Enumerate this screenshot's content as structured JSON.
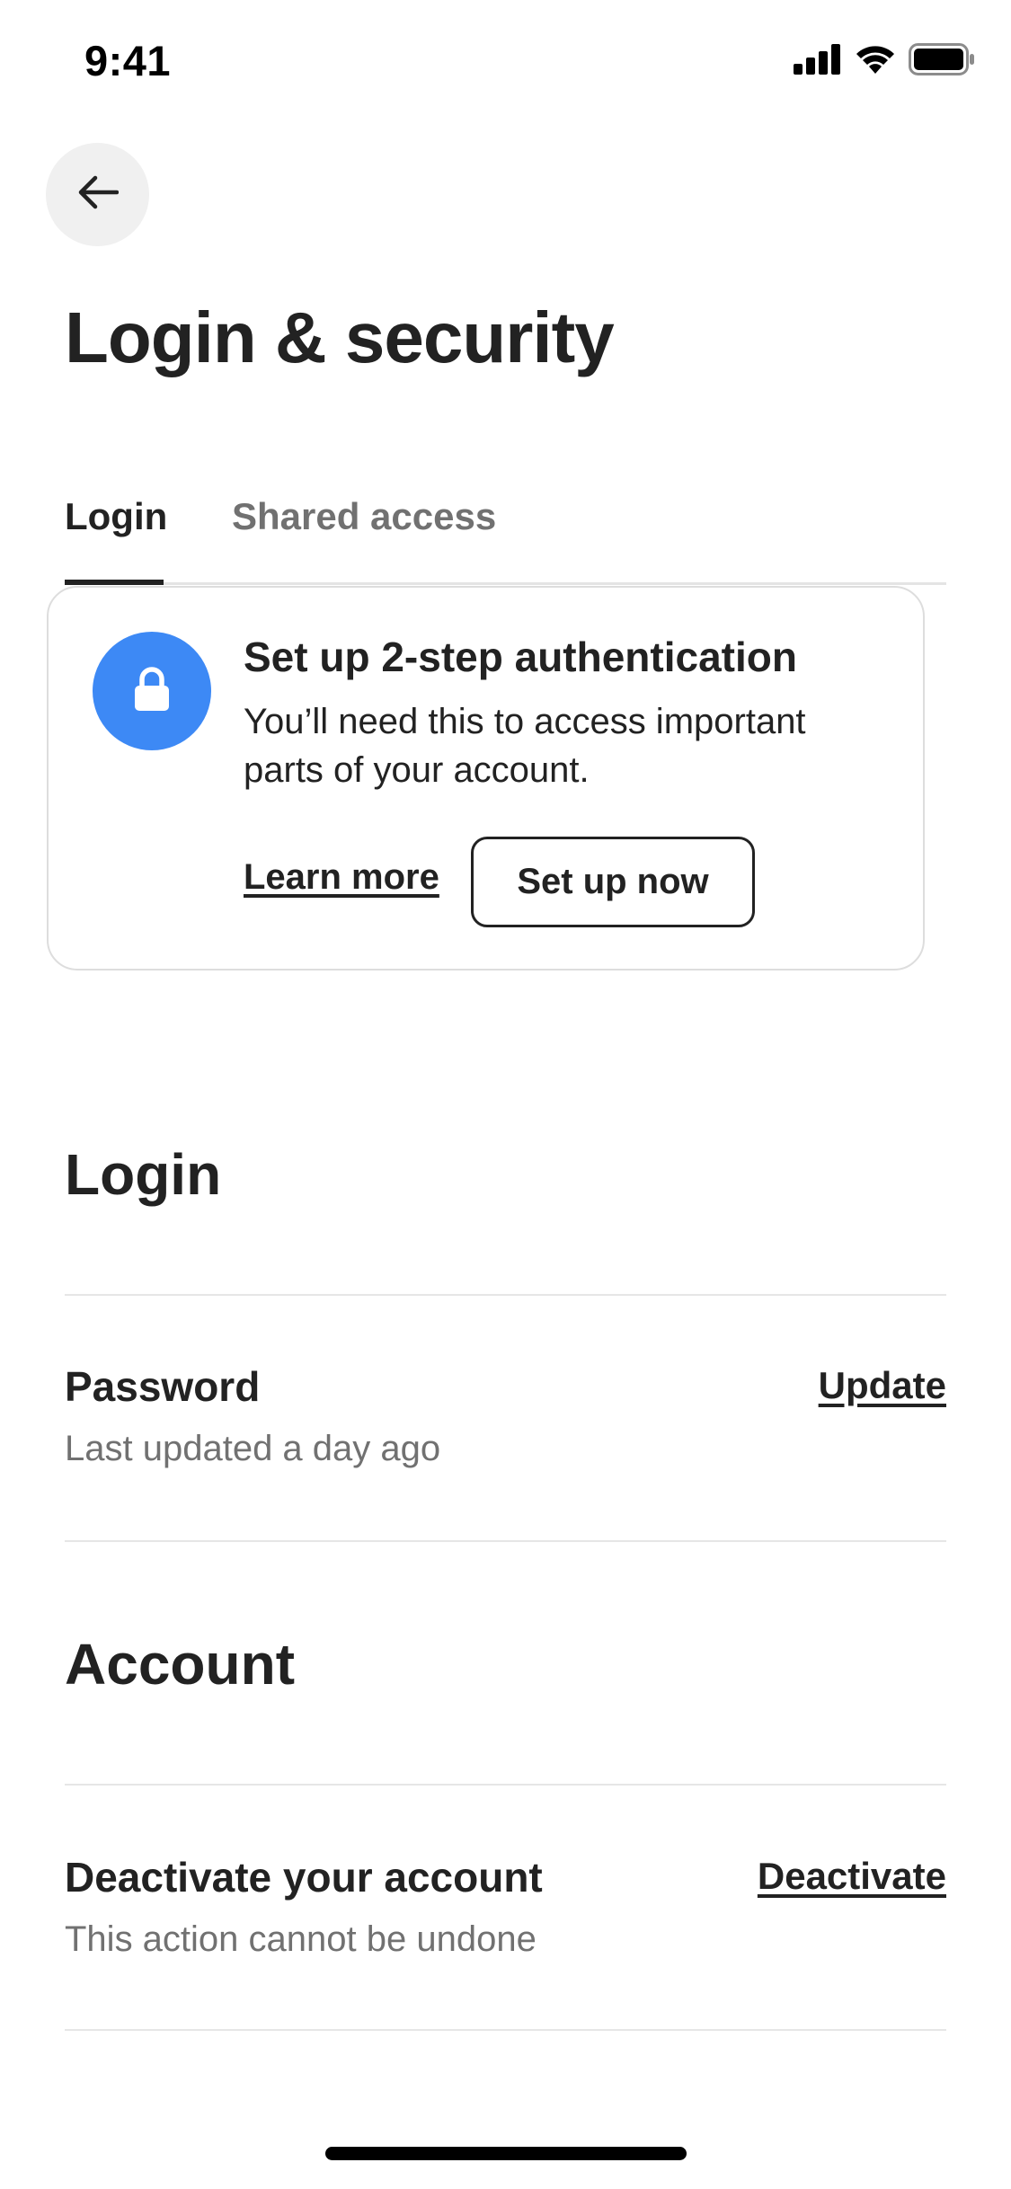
{
  "status_bar": {
    "time": "9:41",
    "icons": [
      "cellular-signal-icon",
      "wifi-icon",
      "battery-icon"
    ]
  },
  "header": {
    "back_icon": "arrow-left-icon",
    "title": "Login & security"
  },
  "tabs": [
    {
      "label": "Login",
      "selected": true
    },
    {
      "label": "Shared access",
      "selected": false
    }
  ],
  "auth_card": {
    "icon": "lock-icon",
    "icon_bg_color": "#3d89f5",
    "title": "Set up 2-step authentication",
    "description": "You’ll need this to access important parts of your account.",
    "learn_more_label": "Learn more",
    "setup_label": "Set up now"
  },
  "login_section": {
    "heading": "Login",
    "password": {
      "title": "Password",
      "subtitle": "Last updated a day ago",
      "action_label": "Update"
    }
  },
  "account_section": {
    "heading": "Account",
    "deactivate": {
      "title": "Deactivate your account",
      "subtitle": "This action cannot be undone",
      "action_label": "Deactivate"
    }
  }
}
